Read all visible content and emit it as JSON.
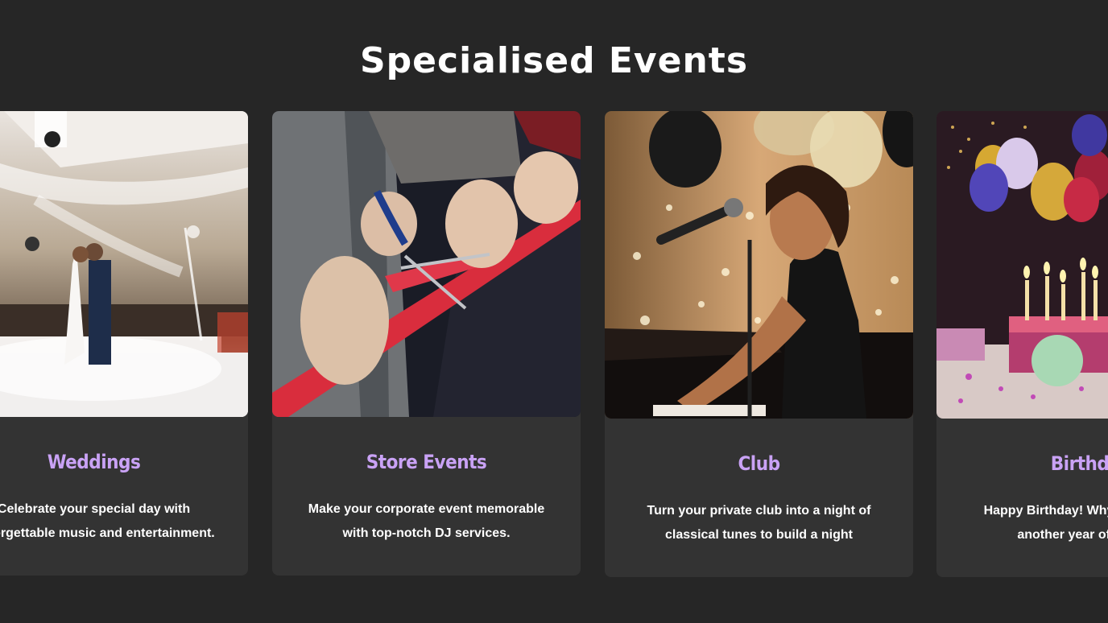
{
  "section": {
    "title": "Specialised Events"
  },
  "cards": [
    {
      "title": "Weddings",
      "description": "Celebrate your special day with unforgettable music and entertainment.",
      "image": "wedding-photo"
    },
    {
      "title": "Store Events",
      "description": "Make your corporate event memorable with top-notch DJ services.",
      "image": "ribbon-cutting-photo"
    },
    {
      "title": "Club",
      "description": "Turn your private club into a night of classical tunes to build a night",
      "image": "pianist-singer-photo"
    },
    {
      "title": "Birthday",
      "description": "Happy Birthday! Why not celebrate another year of your life",
      "image": "birthday-cake-photo"
    }
  ],
  "colors": {
    "background": "#262626",
    "card": "#333333",
    "accent": "#c9a2f5",
    "text": "#ffffff"
  }
}
